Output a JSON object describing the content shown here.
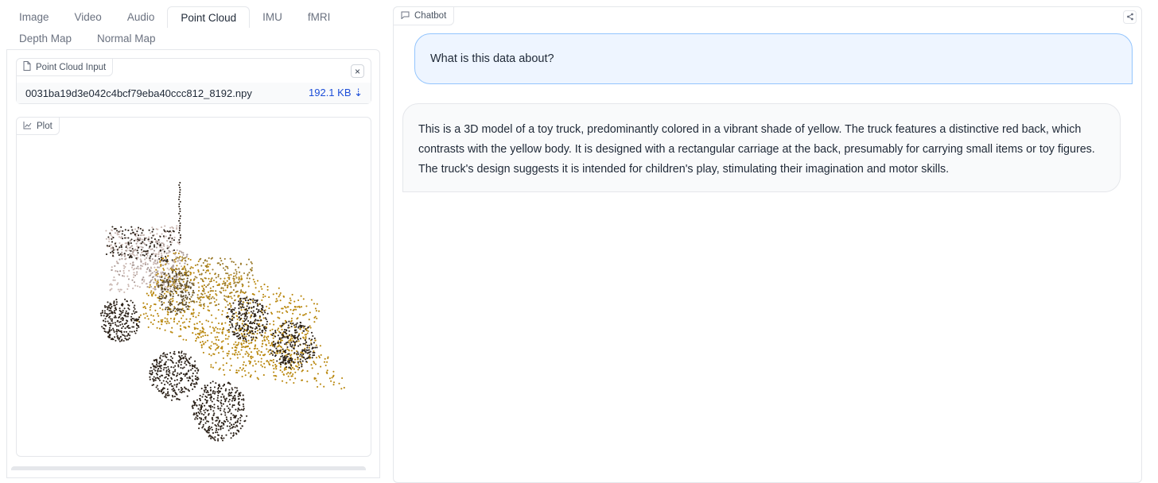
{
  "tabs": {
    "row1": [
      "Image",
      "Video",
      "Audio",
      "Point Cloud",
      "IMU",
      "fMRI"
    ],
    "row2": [
      "Depth Map",
      "Normal Map"
    ],
    "active": "Point Cloud"
  },
  "file_input": {
    "label": "Point Cloud Input",
    "close_glyph": "×",
    "file_name": "0031ba19d3e042c4bcf79eba40ccc812_8192.npy",
    "file_size": "192.1 KB ⇣"
  },
  "plot": {
    "label": "Plot",
    "colors": {
      "yellow": "#b8860b",
      "dark": "#2b2118",
      "pink": "#c9b6b0"
    }
  },
  "chatbot": {
    "label": "Chatbot",
    "messages": [
      {
        "role": "user",
        "text": "What is this data about?"
      },
      {
        "role": "bot",
        "text": "This is a 3D model of a toy truck, predominantly colored in a vibrant shade of yellow. The truck features a distinctive red back, which contrasts with the yellow body. It is designed with a rectangular carriage at the back, presumably for carrying small items or toy figures. The truck's design suggests it is intended for children's play, stimulating their imagination and motor skills."
      }
    ]
  },
  "icons": {
    "file": "file-icon",
    "chart": "chart-icon",
    "chat": "chat-bubble-icon",
    "share": "share-icon"
  }
}
